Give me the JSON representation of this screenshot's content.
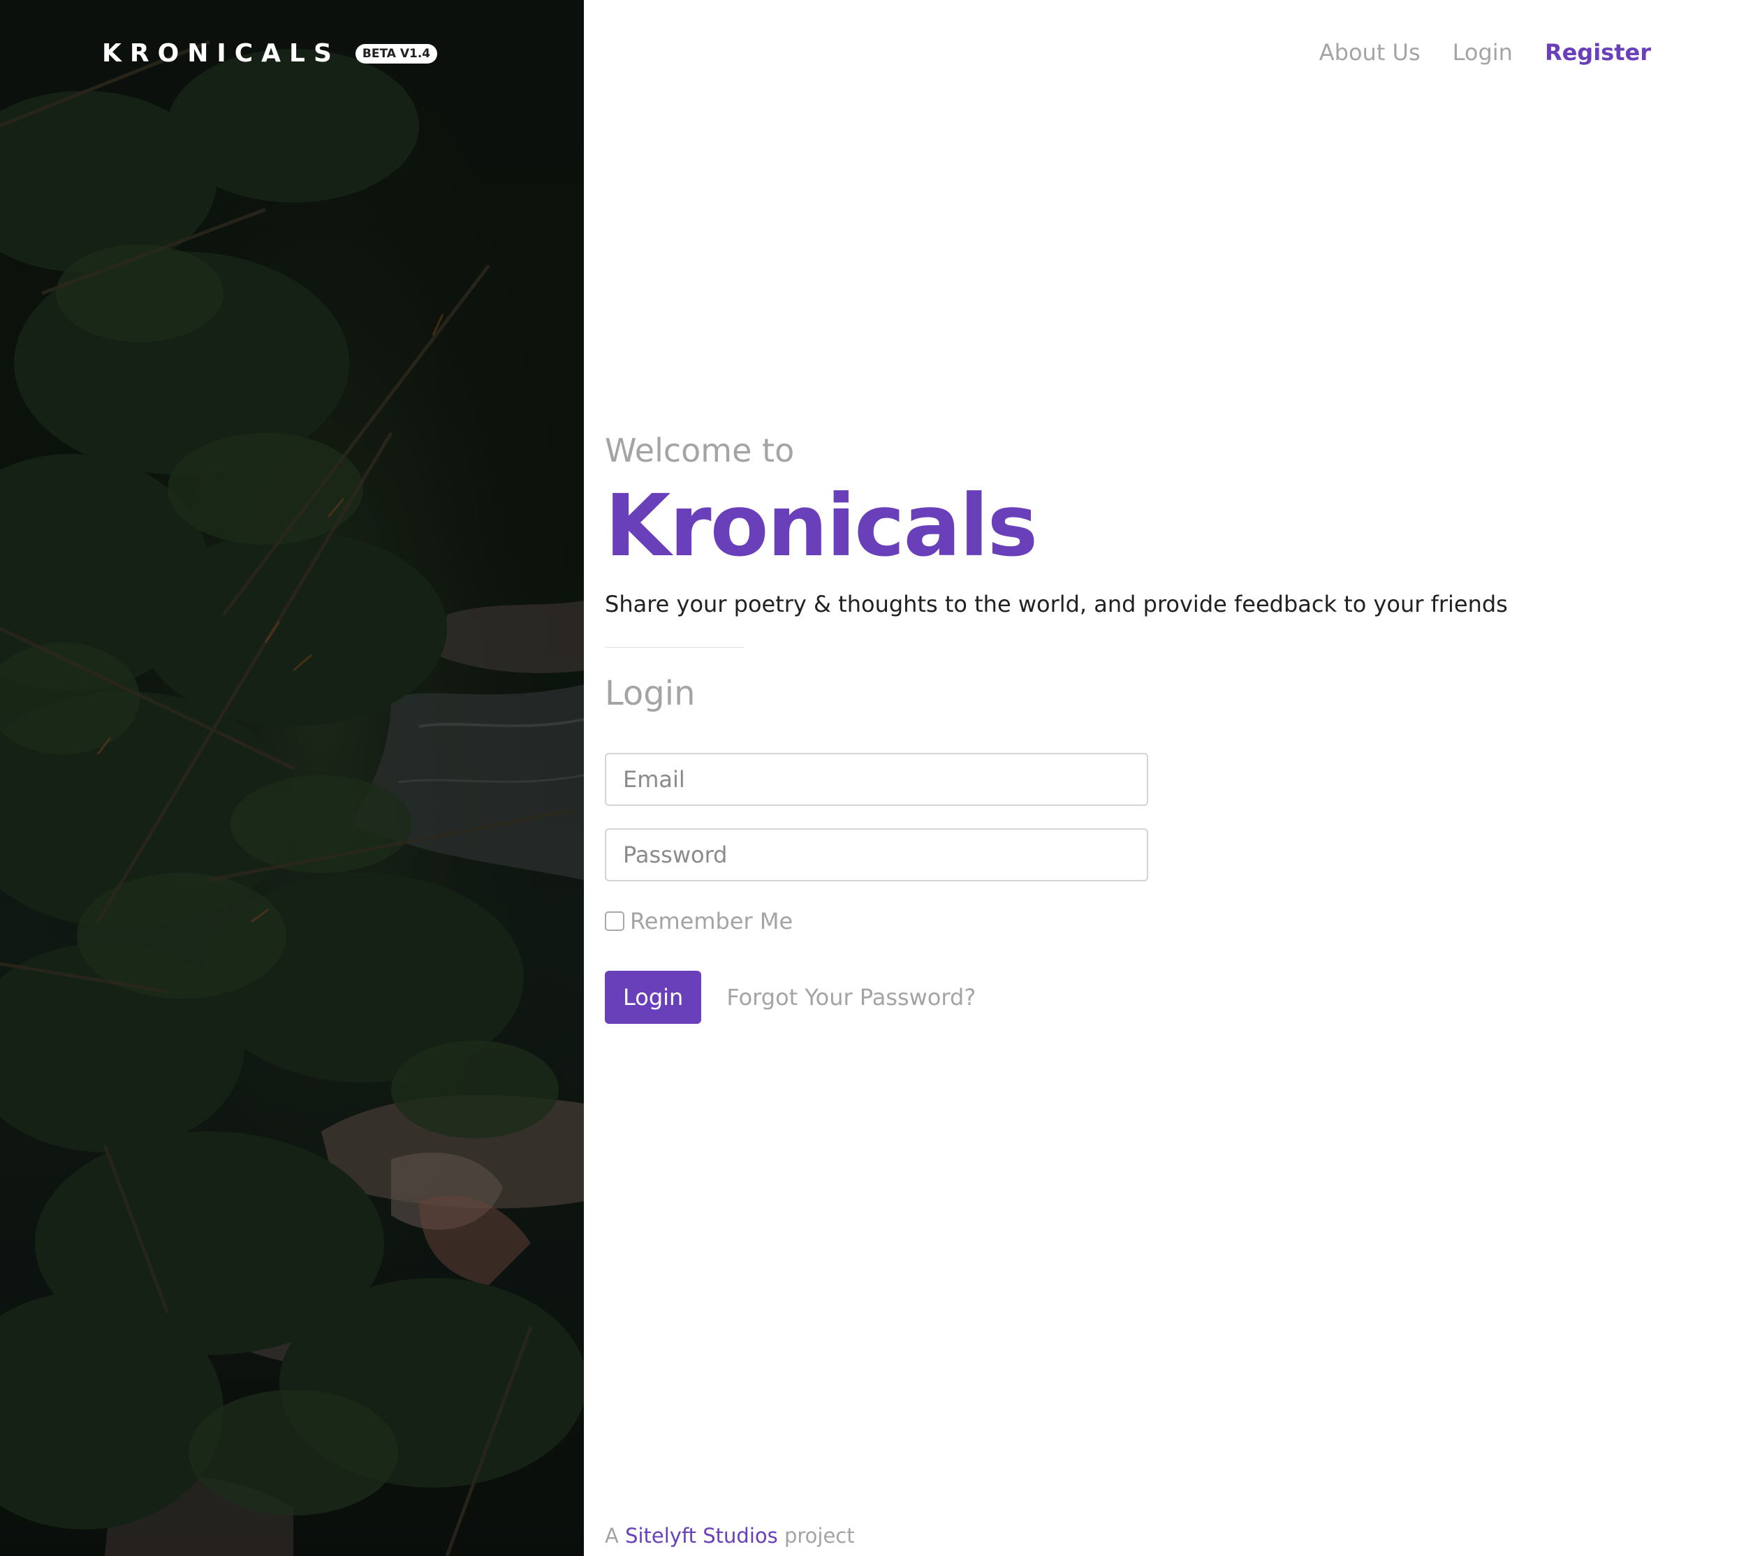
{
  "brand": {
    "name": "KRONICALS",
    "badge": "BETA V1.4"
  },
  "nav": {
    "about": "About Us",
    "login": "Login",
    "register": "Register"
  },
  "hero": {
    "welcome": "Welcome to",
    "title": "Kronicals",
    "tagline": "Share your poetry & thoughts to the world, and provide feedback to your friends"
  },
  "login_form": {
    "heading": "Login",
    "email_placeholder": "Email",
    "email_value": "",
    "password_placeholder": "Password",
    "password_value": "",
    "remember_label": "Remember Me",
    "remember_checked": false,
    "submit_label": "Login",
    "forgot_label": "Forgot Your Password?"
  },
  "footer": {
    "prefix": "A",
    "link": "Sitelyft Studios",
    "suffix": "project"
  },
  "colors": {
    "accent": "#6a3fba",
    "muted": "#a4a4a4",
    "text": "#212121"
  },
  "icons": {
    "checkbox": "checkbox-unchecked-icon"
  }
}
